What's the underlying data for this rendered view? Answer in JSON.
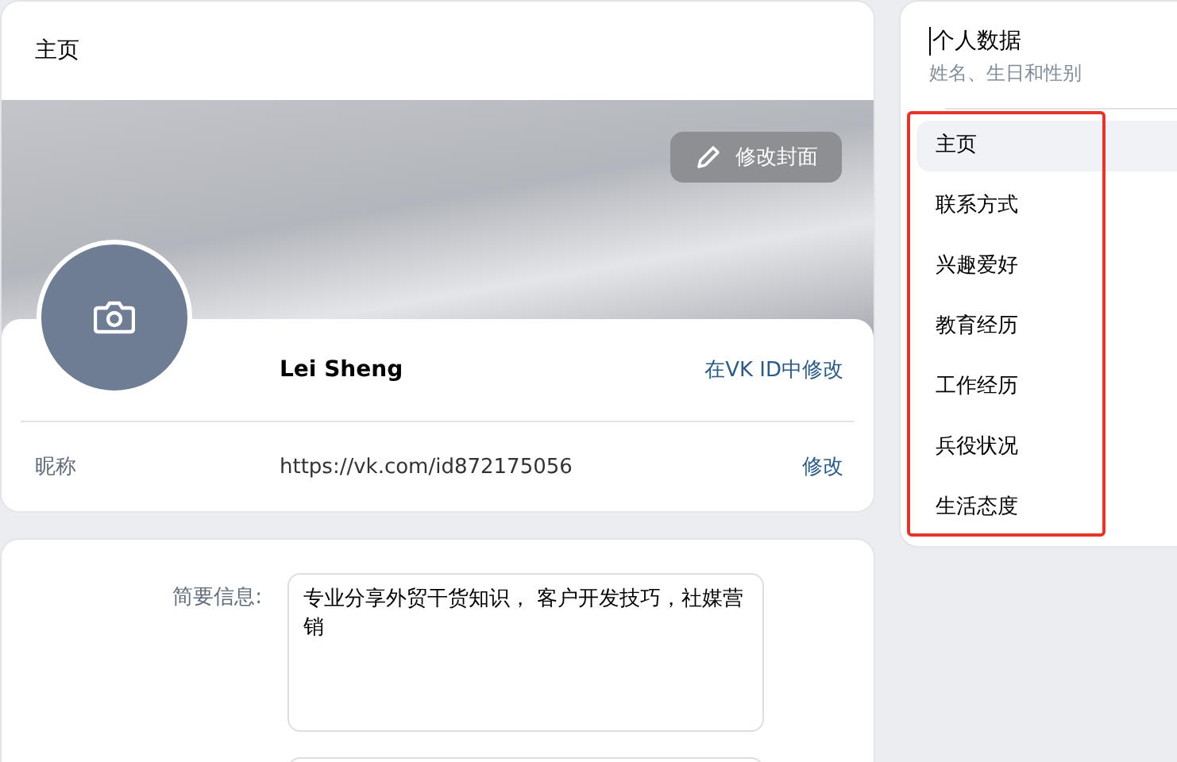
{
  "profile_card": {
    "title": "主页",
    "cover_button": "修改封面",
    "name": "Lei Sheng",
    "name_link": "在VK ID中修改",
    "nickname_label": "昵称",
    "nickname_value": "https://vk.com/id872175056",
    "nickname_link": "修改"
  },
  "info_card": {
    "fields": [
      {
        "label": "简要信息:",
        "value": "专业分享外贸干货知识， 客户开发技巧，社媒营销"
      }
    ]
  },
  "sidebar": {
    "title": "个人数据",
    "subtitle": "姓名、生日和性别",
    "highlighted": true,
    "items": [
      {
        "label": "主页",
        "selected": true
      },
      {
        "label": "联系方式",
        "selected": false
      },
      {
        "label": "兴趣爱好",
        "selected": false
      },
      {
        "label": "教育经历",
        "selected": false
      },
      {
        "label": "工作经历",
        "selected": false
      },
      {
        "label": "兵役状况",
        "selected": false
      },
      {
        "label": "生活态度",
        "selected": false
      }
    ]
  }
}
